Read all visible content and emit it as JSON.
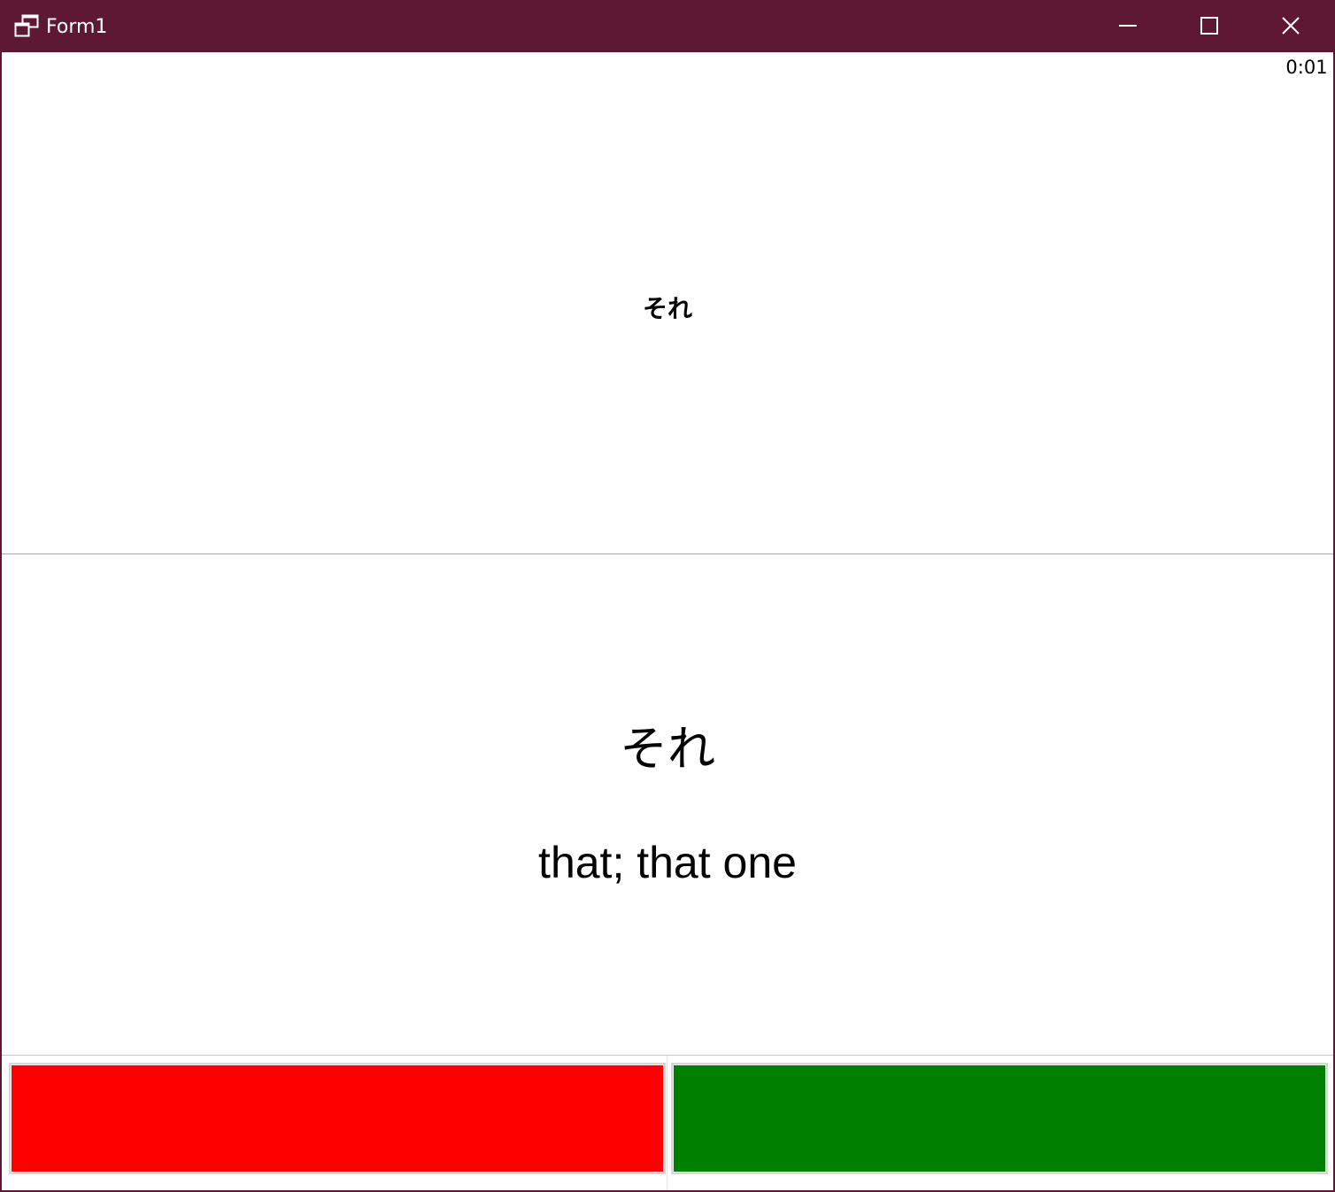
{
  "window": {
    "title": "Form1",
    "titlebar_color": "#5e1834",
    "icons": {
      "app": "app-window-icon",
      "minimize": "minimize-icon",
      "maximize": "maximize-icon",
      "close": "close-icon"
    }
  },
  "timer": {
    "value": "0:01"
  },
  "card": {
    "prompt": "それ",
    "answer_kana": "それ",
    "answer_meaning": "that; that one"
  },
  "buttons": {
    "wrong": {
      "color": "#ff0000"
    },
    "right": {
      "color": "#008000"
    }
  }
}
